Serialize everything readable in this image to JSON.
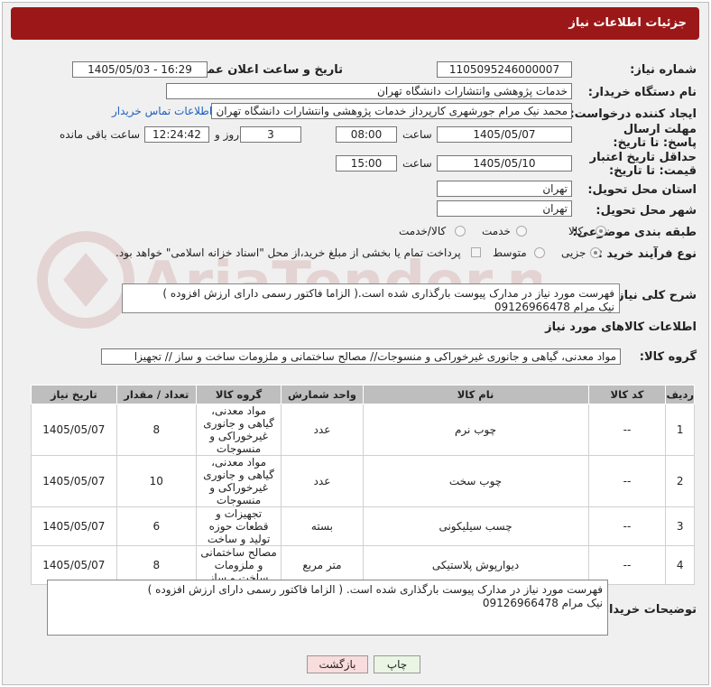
{
  "header": {
    "title": "جزئیات اطلاعات نیاز"
  },
  "labels": {
    "need_number": "شماره نیاز:",
    "announce_datetime": "تاریخ و ساعت اعلان عمومی:",
    "buyer_org": "نام دستگاه خریدار:",
    "request_creator": "ایجاد کننده درخواست:",
    "reply_deadline": "مهلت ارسال پاسخ: تا تاریخ:",
    "min_price_validity": "حداقل تاریخ اعتبار قیمت: تا تاریخ:",
    "time": "ساعت",
    "day_and": "روز و",
    "remaining": "ساعت باقی مانده",
    "delivery_province": "استان محل تحویل:",
    "delivery_city": "شهر محل تحویل:",
    "subject_category": "طبقه بندی موضوعی:",
    "purchase_type": "نوع فرآیند خرید :",
    "general_desc": "شرح کلی نیاز:",
    "goods_info": "اطلاعات کالاهای مورد نیاز",
    "goods_group": "گروه کالا:",
    "buyer_notes": "توضیحات خریدار:"
  },
  "fields": {
    "need_number": "1105095246000007",
    "announce_datetime": "1405/05/03 - 16:29",
    "buyer_org": "خدمات پژوهشی وانتشارات دانشگاه تهران",
    "request_creator": "محمد نیک مرام جورشهری کارپرداز خدمات پژوهشی وانتشارات دانشگاه تهران",
    "contact_link": "اطلاعات تماس خریدار",
    "reply_date": "1405/05/07",
    "reply_time": "08:00",
    "reply_days": "3",
    "reply_remaining": "12:24:42",
    "price_date": "1405/05/10",
    "price_time": "15:00",
    "province": "تهران",
    "city": "تهران",
    "goods_group": "مواد معدنی، گیاهی و جانوری غیرخوراکی و منسوجات// مصالح ساختمانی و ملزومات ساخت و ساز // تجهیزا"
  },
  "category_options": {
    "goods": "کالا",
    "service": "خدمت",
    "goods_service": "کالا/خدمت"
  },
  "purchase_options": {
    "partial": "جزیی",
    "medium": "متوسط",
    "payment_note": "پرداخت تمام یا بخشی از مبلغ خرید،از محل \"اسناد خزانه اسلامی\" خواهد بود."
  },
  "general_desc": "فهرست مورد نیاز در مدارک پیوست بارگذاری شده است.( الزاما فاکتور رسمی دارای ارزش افزوده )\nنیک مرام 09126966478",
  "table": {
    "headers": [
      "ردیف",
      "کد کالا",
      "نام کالا",
      "واحد شمارش",
      "گروه کالا",
      "تعداد / مقدار",
      "تاریخ نیاز"
    ],
    "rows": [
      [
        "1",
        "--",
        "چوب نرم",
        "عدد",
        "مواد معدنی، گیاهی و جانوری غیرخوراکی و منسوجات",
        "8",
        "1405/05/07"
      ],
      [
        "2",
        "--",
        "چوب سخت",
        "عدد",
        "مواد معدنی، گیاهی و جانوری غیرخوراکی و منسوجات",
        "10",
        "1405/05/07"
      ],
      [
        "3",
        "--",
        "چسب سیلیکونی",
        "بسته",
        "تجهیزات و قطعات حوزه تولید و ساخت",
        "6",
        "1405/05/07"
      ],
      [
        "4",
        "--",
        "دیوارپوش پلاستیکی",
        "متر مربع",
        "مصالح ساختمانی و ملزومات ساخت و ساز",
        "8",
        "1405/05/07"
      ]
    ]
  },
  "buyer_notes": "فهرست مورد نیاز در مدارک پیوست بارگذاری شده است. ( الزاما فاکتور رسمی دارای ارزش افزوده )\nنیک مرام 09126966478",
  "buttons": {
    "print": "چاپ",
    "back": "بازگشت"
  },
  "watermark": "AriaTender.net",
  "colors": {
    "header": "#9c1818",
    "print_btn": "#eaf5e4",
    "back_btn": "#f9dcdc",
    "link": "#1f5fbf"
  }
}
